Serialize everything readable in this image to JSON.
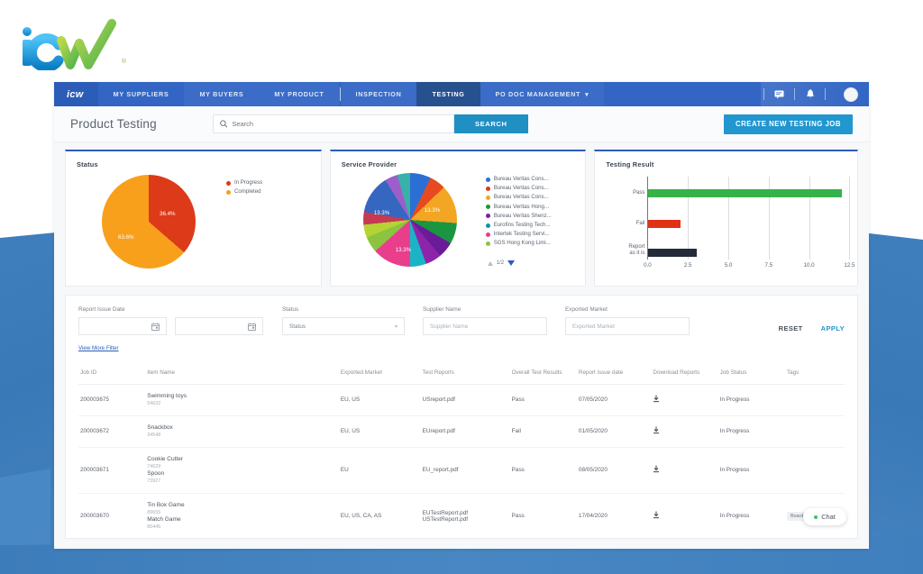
{
  "brand": {
    "logo_text": "icw",
    "registered_mark": "®"
  },
  "nav": {
    "brand": "icw",
    "items": [
      {
        "label": "MY SUPPLIERS",
        "active": false
      },
      {
        "label": "MY BUYERS",
        "active": false
      },
      {
        "label": "MY PRODUCT",
        "active": false
      },
      {
        "label": "INSPECTION",
        "active": false
      },
      {
        "label": "TESTING",
        "active": true
      },
      {
        "label": "PO DOC MANAGEMENT",
        "active": false,
        "caret": "⌄"
      }
    ],
    "icons": [
      "message-icon",
      "bell-icon",
      "avatar"
    ]
  },
  "header": {
    "title": "Product Testing",
    "search": {
      "placeholder": "Search",
      "value": "",
      "icon": "search-icon"
    },
    "search_button": "SEARCH",
    "create_button": "CREATE NEW TESTING JOB"
  },
  "cards": {
    "status": {
      "title": "Status"
    },
    "service_provider": {
      "title": "Service Provider",
      "pager": "1/2"
    },
    "testing_result": {
      "title": "Testing Result"
    }
  },
  "chart_data": [
    {
      "type": "pie",
      "title": "Status",
      "legend_position": "right",
      "labels": [
        "In Progress",
        "Completed"
      ],
      "values": [
        36.4,
        63.6
      ],
      "value_labels": [
        "36.4%",
        "63.6%"
      ],
      "colors": [
        "#dc3a18",
        "#f8a01b"
      ]
    },
    {
      "type": "pie",
      "title": "Service Provider",
      "legend_position": "right",
      "labels": [
        "Bureau Veritas Cons...",
        "Bureau Veritas Cons...",
        "Bureau Veritas Cons...",
        "Bureau Veritas Hong...",
        "Bureau Veritas Shenz...",
        "Eurofins Testing Tech...",
        "Intertek Testing Servi...",
        "SGS Hong Kong Limi..."
      ],
      "legend_colors": [
        "#2b6fd4",
        "#d93a20",
        "#f3a623",
        "#1a9641",
        "#7b1fa2",
        "#1195aa",
        "#e0418e",
        "#8bc53f"
      ],
      "slice_colors": [
        "#2b6fd4",
        "#e8491f",
        "#f3a623",
        "#1a9641",
        "#6a1b9a",
        "#8e24aa",
        "#1bb4c7",
        "#e83e8c",
        "#e0418e",
        "#8bc53f",
        "#b5d334",
        "#c63a53",
        "#3566c0",
        "#9c5fc9",
        "#38b2a8",
        "#2aa198"
      ],
      "values": [
        6.7,
        6.7,
        13.3,
        6.7,
        6.7,
        6.7,
        6.7,
        13.3,
        6.7,
        6.7,
        6.7,
        6.7,
        13.3,
        6.7,
        6.7,
        6.7
      ],
      "visible_labels": [
        "13.3%",
        "13.3%",
        "13.3%"
      ]
    },
    {
      "type": "bar",
      "orientation": "horizontal",
      "title": "Testing Result",
      "categories": [
        "Pass",
        "Fail",
        "Report as it is"
      ],
      "values": [
        12,
        2,
        3
      ],
      "colors": [
        "#35b34a",
        "#e03316",
        "#232b3a"
      ],
      "xlabel": "",
      "ylabel": "",
      "xlim": [
        0,
        12.5
      ],
      "xticks": [
        "0.0",
        "2.5",
        "5.0",
        "7.5",
        "10.0",
        "12.5"
      ],
      "grid": true
    }
  ],
  "filters": {
    "report_issue_date": {
      "label": "Report Issue Date",
      "from_value": "",
      "to_value": "",
      "icon": "calendar-icon"
    },
    "status": {
      "label": "Status",
      "placeholder": "Status",
      "value": "",
      "icon": "chevron-down-icon"
    },
    "supplier_name": {
      "label": "Supplier Name",
      "placeholder": "Supplier Name",
      "value": ""
    },
    "exported_market": {
      "label": "Exported Market",
      "placeholder": "Exported Market",
      "value": ""
    },
    "reset": "RESET",
    "apply": "APPLY",
    "view_more": "View More Filter"
  },
  "table": {
    "columns": [
      "Job ID",
      "Item Name",
      "Exported Market",
      "Test Reports",
      "Overall Test Results",
      "Report issue date",
      "Download Reports",
      "Job Status",
      "Tags"
    ],
    "rows": [
      {
        "job_id": "200003675",
        "items": [
          {
            "name": "Swimming toys",
            "code": "54632"
          }
        ],
        "market": "EU, US",
        "reports": [
          "USreport.pdf"
        ],
        "result": "Pass",
        "date": "07/05/2020",
        "download": "download-icon",
        "status": "In Progress",
        "tags": []
      },
      {
        "job_id": "200003672",
        "items": [
          {
            "name": "Snackbox",
            "code": "34548"
          }
        ],
        "market": "EU, US",
        "reports": [
          "EUreport.pdf"
        ],
        "result": "Fail",
        "date": "01/05/2020",
        "download": "download-icon",
        "status": "In Progress",
        "tags": []
      },
      {
        "job_id": "200003671",
        "items": [
          {
            "name": "Cookie Cutter",
            "code": "74629"
          },
          {
            "name": "Spoon",
            "code": "73927"
          }
        ],
        "market": "EU",
        "reports": [
          "EU_report.pdf"
        ],
        "result": "Pass",
        "date": "08/05/2020",
        "download": "download-icon",
        "status": "In Progress",
        "tags": []
      },
      {
        "job_id": "200003670",
        "items": [
          {
            "name": "Tin Box Game",
            "code": "89655"
          },
          {
            "name": "Match Game",
            "code": "80445"
          }
        ],
        "market": "EU, US, CA, AS",
        "reports": [
          "EUTestReport.pdf",
          "USTestReport.pdf"
        ],
        "result": "Pass",
        "date": "17/04/2020",
        "download": "download-icon",
        "status": "In Progress",
        "tags": [
          "Board Game"
        ]
      }
    ]
  },
  "chat": {
    "label": "Chat",
    "status_color": "#3fbf68"
  }
}
